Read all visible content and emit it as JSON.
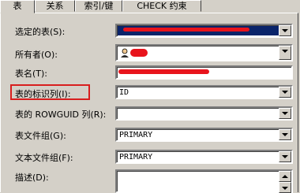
{
  "tabs": [
    {
      "label": "表",
      "active": true
    },
    {
      "label": "关系",
      "active": false
    },
    {
      "label": "索引/键",
      "active": false
    },
    {
      "label": "CHECK 约束",
      "active": false
    }
  ],
  "fields": {
    "selected_table": {
      "label": "选定的表(S):",
      "value": ""
    },
    "owner": {
      "label": "所有者(O):",
      "value": ""
    },
    "table_name": {
      "label": "表名(T):",
      "value": ""
    },
    "identity_column": {
      "label": "表的标识列(I):",
      "value": "ID"
    },
    "rowguid_column": {
      "label": "表的 ROWGUID 列(R):",
      "value": ""
    },
    "table_filegroup": {
      "label": "表文件组(G):",
      "value": "PRIMARY"
    },
    "text_filegroup": {
      "label": "文本文件组(F):",
      "value": "PRIMARY"
    },
    "description": {
      "label": "描述(D):",
      "value": ""
    }
  },
  "colors": {
    "background": "#d4d0c8",
    "highlight_box": "#d81e1e",
    "redaction": "#e8141c",
    "selection": "#0a246a"
  },
  "icons": {
    "owner_icon": "user-icon"
  }
}
